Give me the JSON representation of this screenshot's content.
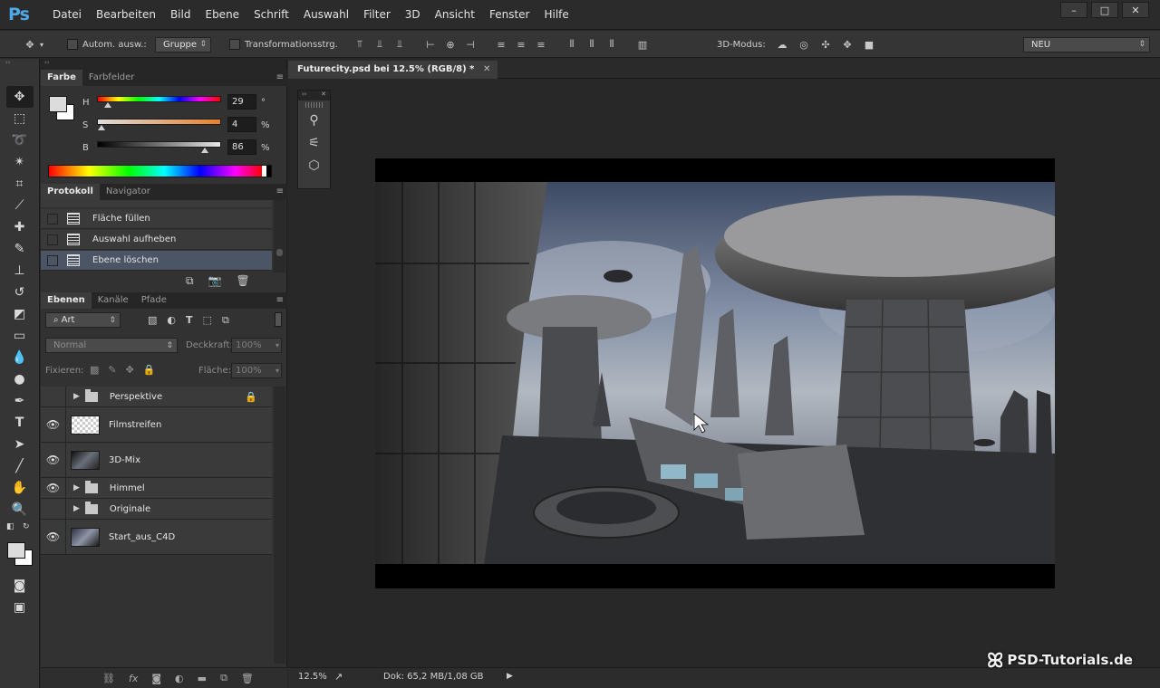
{
  "app": {
    "logo": "Ps"
  },
  "menu": [
    "Datei",
    "Bearbeiten",
    "Bild",
    "Ebene",
    "Schrift",
    "Auswahl",
    "Filter",
    "3D",
    "Ansicht",
    "Fenster",
    "Hilfe"
  ],
  "window_controls": {
    "minimize": "–",
    "maximize": "□",
    "close": "✕"
  },
  "options": {
    "auto_select_label": "Autom. ausw.:",
    "auto_select_value": "Gruppe",
    "transform_label": "Transformationsstrg.",
    "mode3d_label": "3D-Modus:",
    "workspace": "NEU"
  },
  "color_panel": {
    "tabs": [
      "Farbe",
      "Farbfelder"
    ],
    "h_label": "H",
    "h_value": "29",
    "h_unit": "°",
    "s_label": "S",
    "s_value": "4",
    "s_unit": "%",
    "b_label": "B",
    "b_value": "86",
    "b_unit": "%"
  },
  "history_panel": {
    "tabs": [
      "Protokoll",
      "Navigator"
    ],
    "items": [
      {
        "label": "Fläche füllen"
      },
      {
        "label": "Auswahl aufheben"
      },
      {
        "label": "Ebene löschen"
      }
    ]
  },
  "layers_panel": {
    "tabs": [
      "Ebenen",
      "Kanäle",
      "Pfade"
    ],
    "filter_kind": "Art",
    "blend_mode": "Normal",
    "opacity_label": "Deckkraft:",
    "opacity_value": "100%",
    "lock_label": "Fixieren:",
    "fill_label": "Fläche:",
    "fill_value": "100%",
    "layers": [
      {
        "name": "Perspektive",
        "type": "group",
        "visible": false,
        "locked": true
      },
      {
        "name": "Filmstreifen",
        "type": "layer",
        "visible": true
      },
      {
        "name": "3D-Mix",
        "type": "layer",
        "visible": true
      },
      {
        "name": "Himmel",
        "type": "group",
        "visible": true
      },
      {
        "name": "Originale",
        "type": "group",
        "visible": false
      },
      {
        "name": "Start_aus_C4D",
        "type": "layer",
        "visible": true
      }
    ]
  },
  "document": {
    "tab_title": "Futurecity.psd bei 12.5% (RGB/8) *",
    "zoom": "12.5%",
    "doc_size": "Dok: 65,2 MB/1,08 GB"
  },
  "watermark": "PSD-Tutorials.de"
}
